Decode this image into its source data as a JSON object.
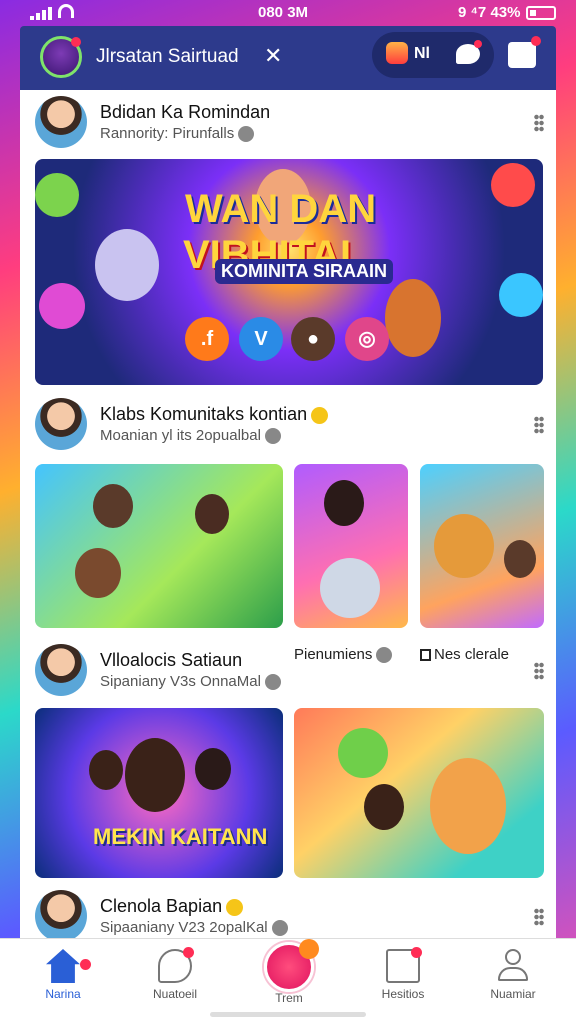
{
  "status_bar": {
    "time": "080 3M",
    "right_text": "9 ⁴7 43%"
  },
  "topbar": {
    "title": "Jlrsatan Sairtuad",
    "close_glyph": "✕",
    "pill_text": "Nl"
  },
  "posts": [
    {
      "name": "Bdidan Ka Romindan",
      "subtitle": "Rannority: Pirunfalls"
    },
    {
      "name": "Klabs Komunitaks kontian",
      "subtitle": "Moanian yl its 2opualbal"
    },
    {
      "name": "Vlloalocis Satiaun",
      "subtitle": "Sipaniany V3s OnnaMal"
    },
    {
      "name": "Clenola Bapian",
      "subtitle": "Sipaaniany V23 2opalKal"
    }
  ],
  "banner": {
    "line1": "WAN DAN",
    "line2": "VIBHITAI",
    "line3": "KOMINITA SIRAAIN"
  },
  "post3_side": {
    "label1": "Pienumiens",
    "label2": "Nes clerale"
  },
  "image_caption": "MEKIN KAITANN",
  "nav": [
    {
      "label": "Narina",
      "icon": "home-icon",
      "active": true
    },
    {
      "label": "Nuatoeil",
      "icon": "chat-bubble-icon"
    },
    {
      "label": "Trem",
      "icon": "create-icon"
    },
    {
      "label": "Hesitios",
      "icon": "news-icon"
    },
    {
      "label": "Nuamiar",
      "icon": "profile-icon"
    }
  ],
  "colors": {
    "topbar": "#2d3a8c",
    "accent": "#2a5fd6",
    "badge": "#ff2d55",
    "center_button": "#e0135f"
  }
}
